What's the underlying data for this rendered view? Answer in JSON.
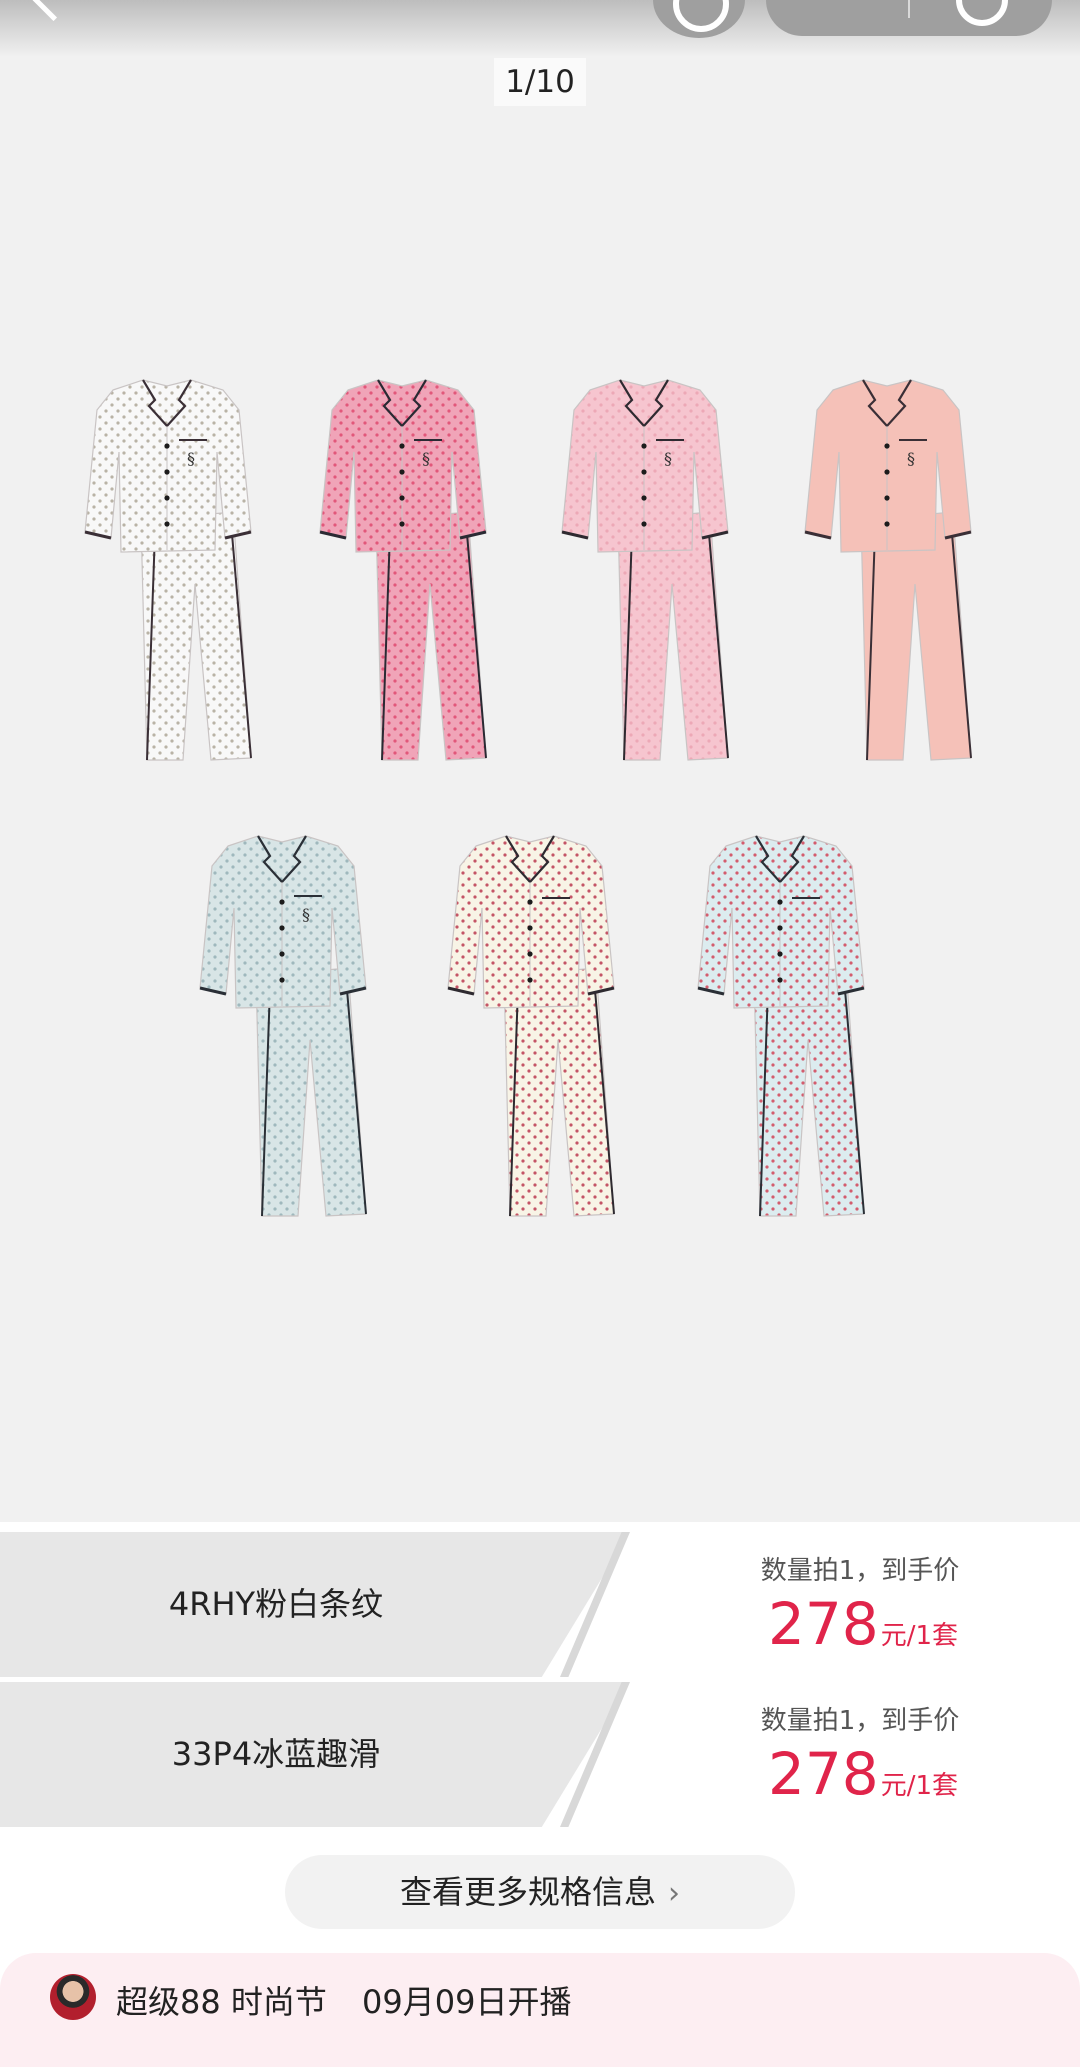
{
  "gallery": {
    "indicator": "1/10",
    "pajamas": [
      {
        "color": "#f8f8f8",
        "pattern": "#b9b3a6",
        "piping": "#3a2f36",
        "logo": true
      },
      {
        "color": "#f0a4b8",
        "pattern": "#e2577a",
        "piping": "#2a2a33",
        "logo": true
      },
      {
        "color": "#f6c5cf",
        "pattern": "#eda8b6",
        "piping": "#2e2a30",
        "logo": true
      },
      {
        "color": "#f5c1b8",
        "pattern": null,
        "piping": "#3a2f36",
        "logo": true
      },
      {
        "color": "#d8e5e6",
        "pattern": "#9fb8bd",
        "piping": "#2a2f36",
        "logo": true
      },
      {
        "color": "#f8f4e6",
        "pattern": "#c45566",
        "piping": "#2e2a30",
        "logo": false
      },
      {
        "color": "#dcecef",
        "pattern": "#d35d6e",
        "piping": "#2a2f36",
        "logo": false
      }
    ]
  },
  "specs": [
    {
      "name": "4RHY粉白条纹",
      "hint": "数量拍1，到手价",
      "price": "278",
      "unit": "元/1套"
    },
    {
      "name": "33P4冰蓝趣滑",
      "hint": "数量拍1，到手价",
      "price": "278",
      "unit": "元/1套"
    }
  ],
  "more": {
    "label": "查看更多规格信息",
    "chevron": "›"
  },
  "live": {
    "title": "超级88 时尚节",
    "date": "09月09日开播"
  },
  "colors": {
    "accent": "#e0244a",
    "live_bg": "#fdeef2"
  }
}
